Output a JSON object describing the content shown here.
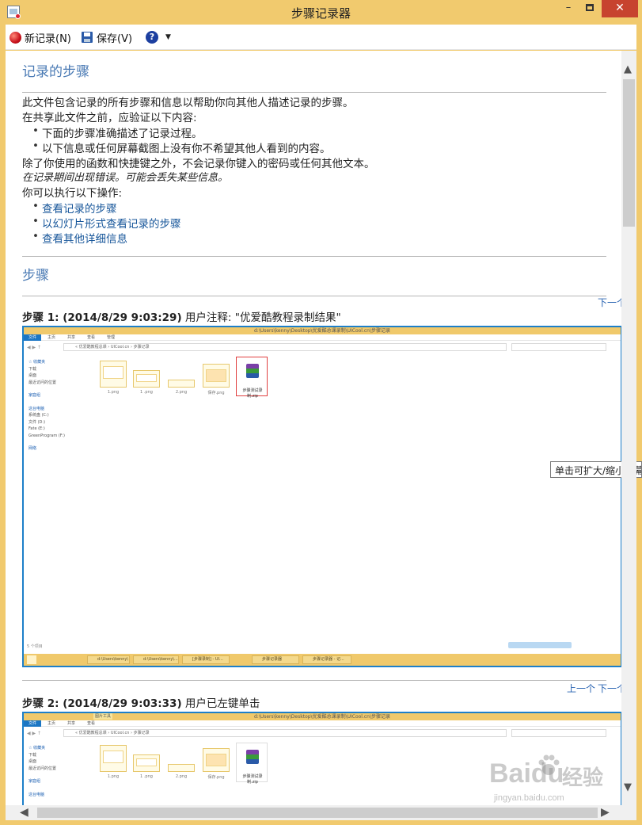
{
  "window": {
    "title": "步骤记录器",
    "minimize": "–",
    "close": "✕"
  },
  "toolbar": {
    "new_record": "新记录(N)",
    "save": "保存(V)",
    "help": "?",
    "caret": "▼"
  },
  "header": {
    "title": "记录的步骤",
    "intro1": "此文件包含记录的所有步骤和信息以帮助你向其他人描述记录的步骤。",
    "intro2": "在共享此文件之前，应验证以下内容:",
    "check1": "下面的步骤准确描述了记录过程。",
    "check2": "以下信息或任何屏幕截图上没有你不希望其他人看到的内容。",
    "intro3": "除了你使用的函数和快捷键之外，不会记录你键入的密码或任何其他文本。",
    "note": "在记录期间出现错误。可能会丢失某些信息。",
    "actions_label": "你可以执行以下操作:",
    "links": [
      "查看记录的步骤",
      "以幻灯片形式查看记录的步骤",
      "查看其他详细信息"
    ]
  },
  "steps_section": {
    "title": "步骤",
    "nav_next": "下一个",
    "nav_prev": "上一个",
    "step1": {
      "label": "步骤 1: (2014/8/29 9:03:29)",
      "desc": "用户注释: \"优爱酷教程录制结果\""
    },
    "step2": {
      "label": "步骤 2: (2014/8/29 9:03:33)",
      "desc": "用户已左键单击"
    }
  },
  "tooltip": "单击可扩大/缩小屏幕",
  "screenshot": {
    "title_path": "d:\\Users\\kenny\\Desktop\\优爱酷总课录制\\UICool.cn\\步骤记录",
    "tab_file": "文件",
    "tabs": [
      "主页",
      "共享",
      "查看",
      "管理"
    ],
    "tab_manage_header": "图片工具",
    "address": "« 优爱酷教程总课 › UICool.cn › 步骤记录",
    "sidebar_favorites": "☆ 收藏夹",
    "sidebar_items": [
      "下载",
      "桌面",
      "最近访问的位置"
    ],
    "sidebar_homegroup": "家庭组",
    "sidebar_pc": "这台电脑",
    "sidebar_drives": [
      "系统盘 (C:)",
      "文件 (D:)",
      "Fate (E:)",
      "GreenProgram (F:)"
    ],
    "sidebar_network": "网络",
    "files": [
      "1.png",
      "1 .png",
      "2.png",
      "保存.png"
    ],
    "rar_name": "步骤测试录制.zip",
    "status": "5 个项目",
    "taskbar": [
      "d:\\Users\\kenny\\",
      "d:\\Users\\kenny\\...",
      "[步骤录制] - UI...",
      "步骤记录器",
      "步骤记录器 - 记..."
    ]
  },
  "watermark": {
    "brand": "Baidu",
    "jingyan": "经验",
    "url": "jingyan.baidu.com"
  }
}
